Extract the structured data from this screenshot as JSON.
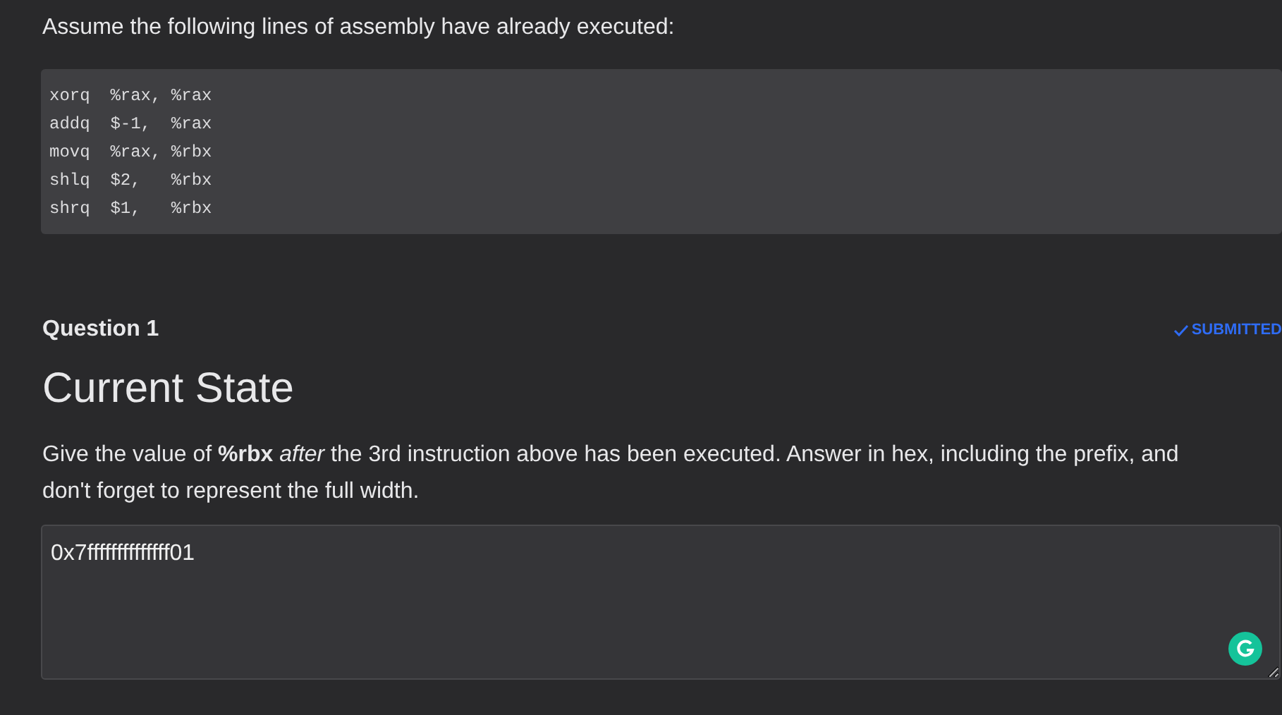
{
  "intro": "Assume the following lines of assembly have already executed:",
  "code_lines": [
    "xorq  %rax, %rax",
    "addq  $-1,  %rax",
    "movq  %rax, %rbx",
    "shlq  $2,   %rbx",
    "shrq  $1,   %rbx"
  ],
  "question": {
    "label": "Question 1",
    "status": {
      "text": "SUBMITTED",
      "submitted": true
    },
    "title": "Current State",
    "prompt": "Give the value of **%rbx** *after* the 3rd instruction above has been executed. Answer in hex, including the prefix, and don't forget to represent the full width.",
    "answer": {
      "value": "0x7ffffffffffffff01"
    }
  }
}
